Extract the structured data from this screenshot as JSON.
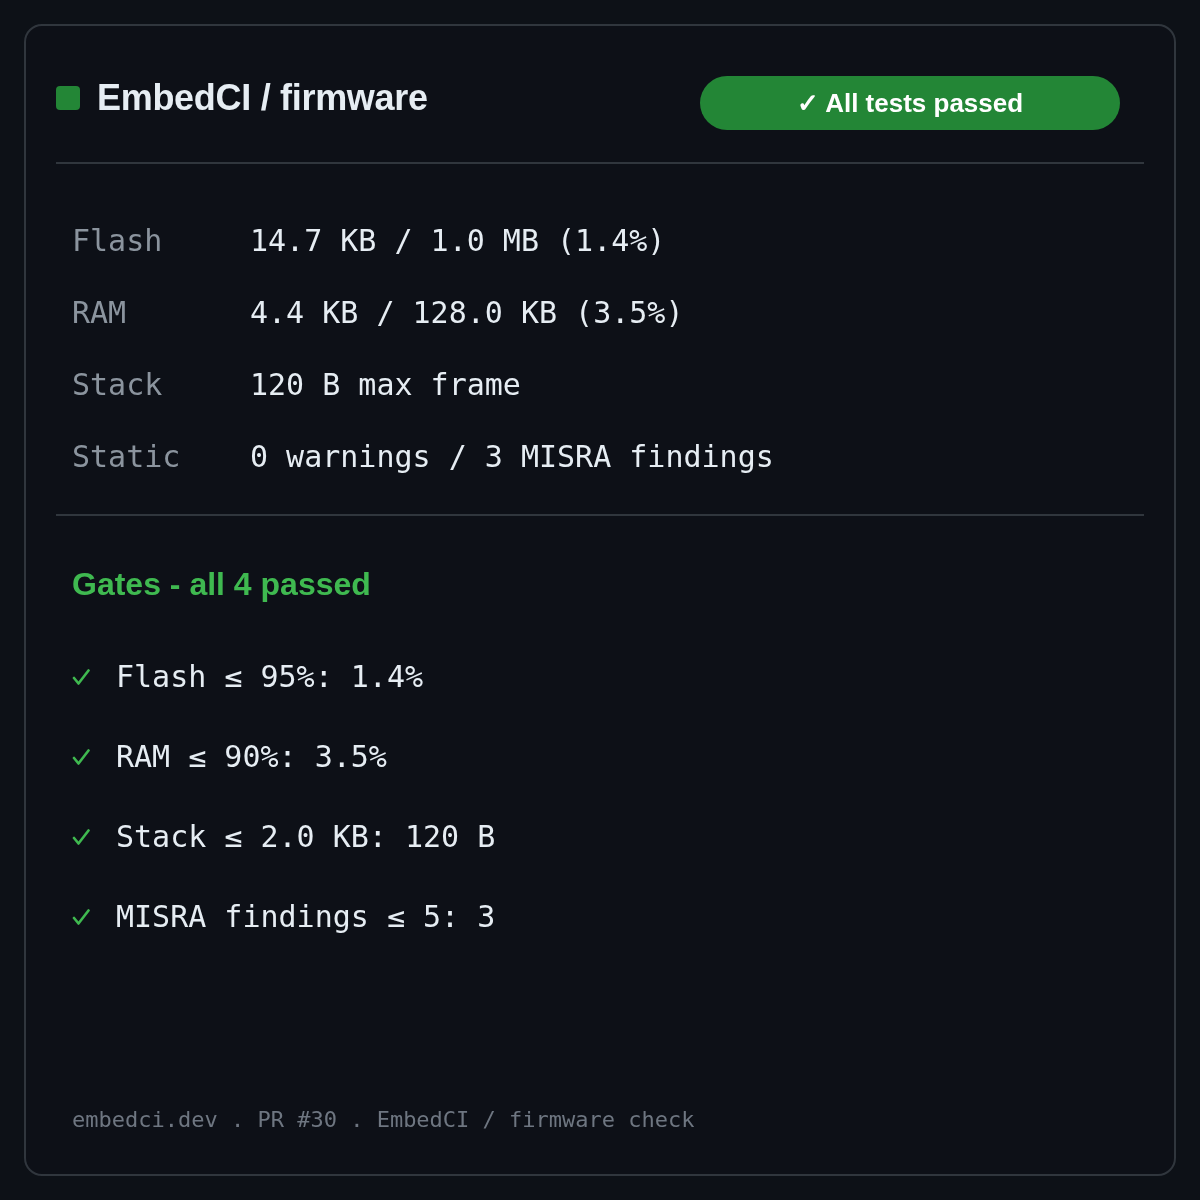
{
  "header": {
    "title": "EmbedCI / firmware",
    "status_badge": "✓ All tests passed"
  },
  "metrics": [
    {
      "label": "Flash",
      "value": "14.7 KB / 1.0 MB (1.4%)"
    },
    {
      "label": "RAM",
      "value": "4.4 KB / 128.0 KB (3.5%)"
    },
    {
      "label": "Stack",
      "value": "120 B max frame"
    },
    {
      "label": "Static",
      "value": "0 warnings / 3 MISRA findings"
    }
  ],
  "gates": {
    "title": "Gates - all 4 passed",
    "items": [
      {
        "text": "Flash ≤ 95%: 1.4%",
        "passed": true
      },
      {
        "text": "RAM ≤ 90%: 3.5%",
        "passed": true
      },
      {
        "text": "Stack ≤ 2.0 KB: 120 B",
        "passed": true
      },
      {
        "text": "MISRA findings ≤ 5: 3",
        "passed": true
      }
    ]
  },
  "footer": "embedci.dev . PR #30 . EmbedCI / firmware check"
}
